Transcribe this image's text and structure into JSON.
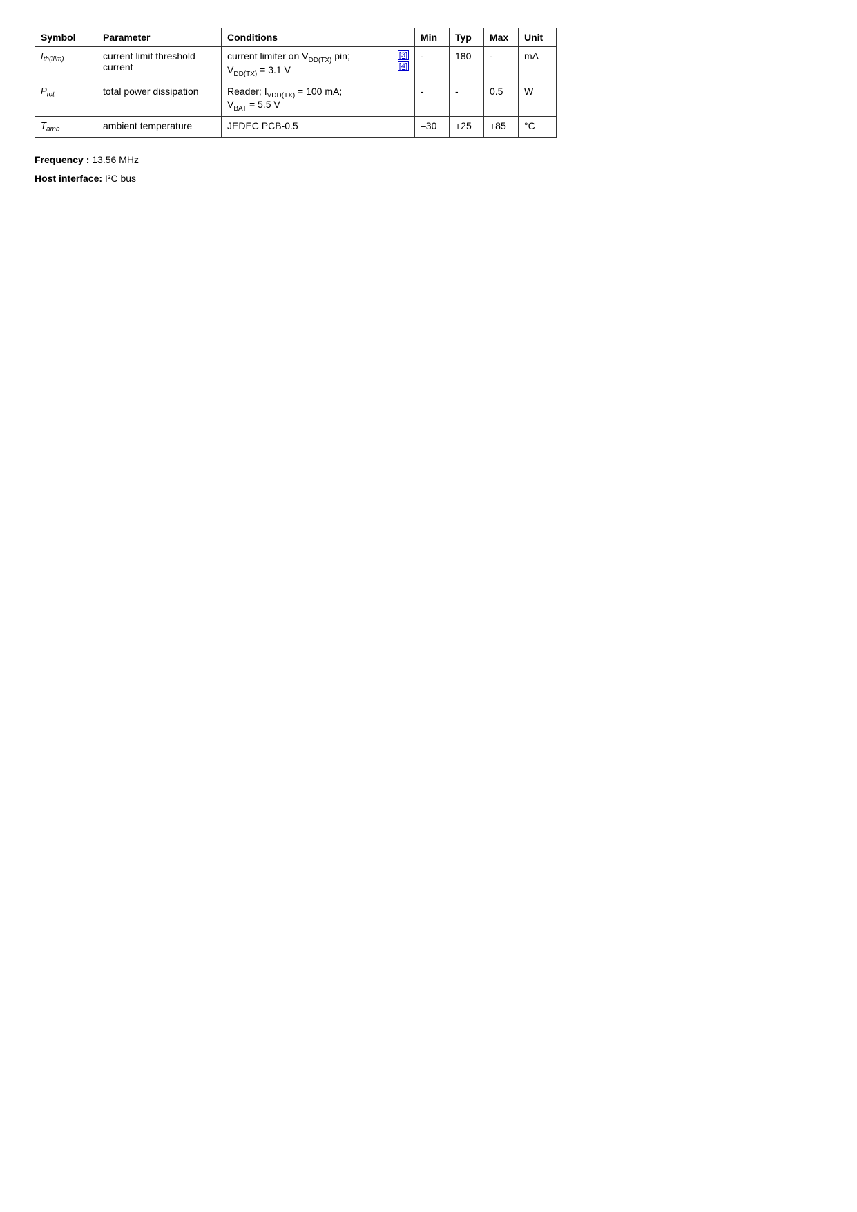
{
  "table": {
    "headers": [
      "Symbol",
      "Parameter",
      "Conditions",
      "Min",
      "Typ",
      "Max",
      "Unit"
    ],
    "rows": [
      {
        "symbol": "I_th(ilim)",
        "symbol_base": "I",
        "symbol_sub": "th(ilim)",
        "parameter": "current limit threshold current",
        "conditions_line1": "current limiter on V",
        "conditions_vddtx": "DD(TX)",
        "conditions_line1_end": " pin;",
        "conditions_line2": "V",
        "conditions_vddtx2": "DD(TX)",
        "conditions_line2_end": " = 3.1 V",
        "ref1": "[3]",
        "ref2": "[4]",
        "min": "-",
        "typ": "180",
        "max": "-",
        "unit": "mA"
      },
      {
        "symbol": "P_tot",
        "symbol_base": "P",
        "symbol_sub": "tot",
        "parameter": "total power dissipation",
        "conditions_line1": "Reader; I",
        "conditions_ivddtx": "VDD(TX)",
        "conditions_line1_end": " = 100 mA;",
        "conditions_line2": "V",
        "conditions_bat": "BAT",
        "conditions_line2_end": " = 5.5 V",
        "min": "-",
        "typ": "-",
        "max": "0.5",
        "unit": "W"
      },
      {
        "symbol": "T_amb",
        "symbol_base": "T",
        "symbol_sub": "amb",
        "parameter": "ambient temperature",
        "conditions": "JEDEC PCB-0.5",
        "min": "–30",
        "typ": "+25",
        "max": "+85",
        "unit": "°C"
      }
    ]
  },
  "footer": {
    "frequency_label": "Frequency :",
    "frequency_value": " 13.56 MHz",
    "host_label": "Host interface:",
    "host_value": " I²C bus"
  }
}
